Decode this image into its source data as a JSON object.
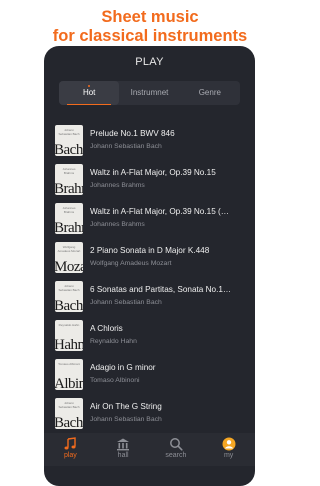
{
  "promo": {
    "line1": "Sheet music",
    "line2": "for classical instruments"
  },
  "screen": {
    "title": "PLAY"
  },
  "tabs": [
    {
      "label": "Hot",
      "active": true
    },
    {
      "label": "Instrumnet",
      "active": false
    },
    {
      "label": "Genre",
      "active": false
    }
  ],
  "pieces": [
    {
      "title": "Prelude No.1 BWV 846",
      "composer": "Johann Sebastian Bach",
      "cover_word": "Bach"
    },
    {
      "title": "Waltz in A-Flat Major, Op.39 No.15",
      "composer": "Johannes Brahms",
      "cover_word": "Brahms"
    },
    {
      "title": "Waltz in A-Flat Major, Op.39 No.15 (…",
      "composer": "Johannes Brahms",
      "cover_word": "Brahms"
    },
    {
      "title": "2 Piano Sonata in D Major K.448",
      "composer": "Wolfgang Amadeus Mozart",
      "cover_word": "Mozart"
    },
    {
      "title": "6 Sonatas and Partitas, Sonata No.1…",
      "composer": "Johann Sebastian Bach",
      "cover_word": "Bach"
    },
    {
      "title": "A Chloris",
      "composer": "Reynaldo Hahn",
      "cover_word": "Hahn"
    },
    {
      "title": "Adagio in G minor",
      "composer": "Tomaso Albinoni",
      "cover_word": "Albinoni"
    },
    {
      "title": "Air On The G String",
      "composer": "Johann Sebastian Bach",
      "cover_word": "Bach"
    }
  ],
  "nav": [
    {
      "label": "play",
      "icon": "music-note-icon",
      "active": true
    },
    {
      "label": "hall",
      "icon": "concert-hall-icon",
      "active": false
    },
    {
      "label": "search",
      "icon": "search-icon",
      "active": false
    },
    {
      "label": "my",
      "icon": "profile-icon",
      "active": false
    }
  ],
  "colors": {
    "accent": "#f26b1d",
    "panel": "#24262d"
  }
}
